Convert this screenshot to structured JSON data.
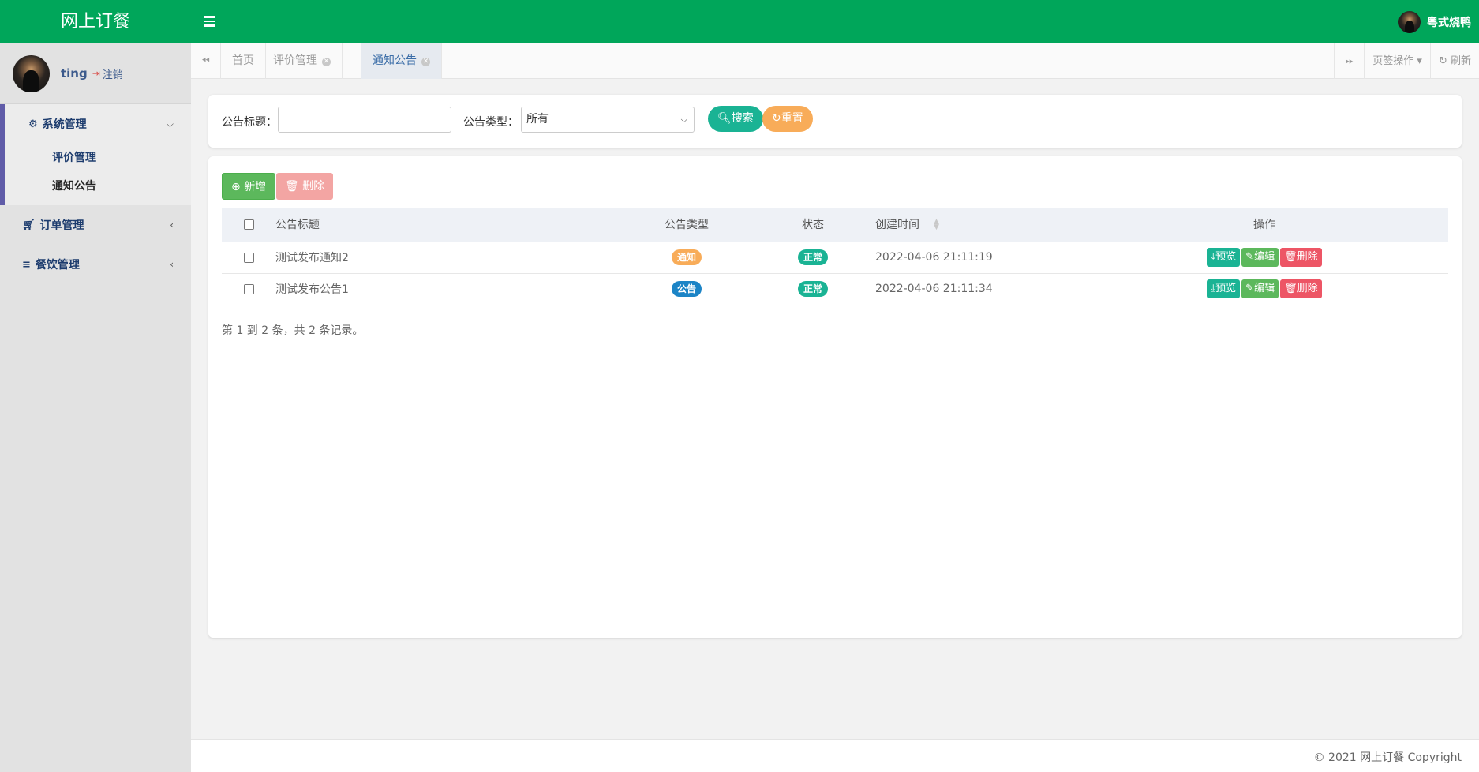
{
  "app": {
    "title": "网上订餐",
    "current_user": "粤式烧鸭",
    "colors": {
      "header": "#00a65a",
      "sidebar": "#e2e2e2",
      "accent": "#605ca8"
    }
  },
  "sidebar": {
    "user": {
      "name": "ting",
      "logout_label": "注销"
    },
    "groups": [
      {
        "label": "系统管理",
        "icon": "gear-icon",
        "expanded": true,
        "items": [
          {
            "label": "评价管理"
          },
          {
            "label": "通知公告",
            "active": true
          }
        ]
      },
      {
        "label": "订单管理",
        "icon": "cart-icon",
        "expanded": false
      },
      {
        "label": "餐饮管理",
        "icon": "list-icon",
        "expanded": false
      }
    ]
  },
  "tabs": {
    "items": [
      {
        "label": "首页",
        "closable": false
      },
      {
        "label": "评价管理",
        "closable": true
      },
      {
        "label": "通知公告",
        "closable": true,
        "active": true
      }
    ],
    "page_ops_label": "页签操作",
    "refresh_label": "刷新"
  },
  "search": {
    "title_label": "公告标题：",
    "title_value": "",
    "type_label": "公告类型：",
    "type_selected": "所有",
    "search_button": "搜索",
    "reset_button": "重置"
  },
  "toolbar": {
    "add_label": "新增",
    "delete_label": "删除"
  },
  "table": {
    "columns": [
      "公告标题",
      "公告类型",
      "状态",
      "创建时间",
      "操作"
    ],
    "rows": [
      {
        "title": "测试发布通知2",
        "type": "通知",
        "type_color": "#f8ac59",
        "status": "正常",
        "status_color": "#1ab394",
        "created": "2022-04-06 21:11:19"
      },
      {
        "title": "测试发布公告1",
        "type": "公告",
        "type_color": "#1c84c6",
        "status": "正常",
        "status_color": "#1ab394",
        "created": "2022-04-06 21:11:34"
      }
    ],
    "row_actions": {
      "preview": "预览",
      "edit": "编辑",
      "delete": "删除"
    },
    "pager_text": "第 1 到 2 条，共 2 条记录。"
  },
  "footer": {
    "copyright": "© 2021 网上订餐 Copyright"
  }
}
